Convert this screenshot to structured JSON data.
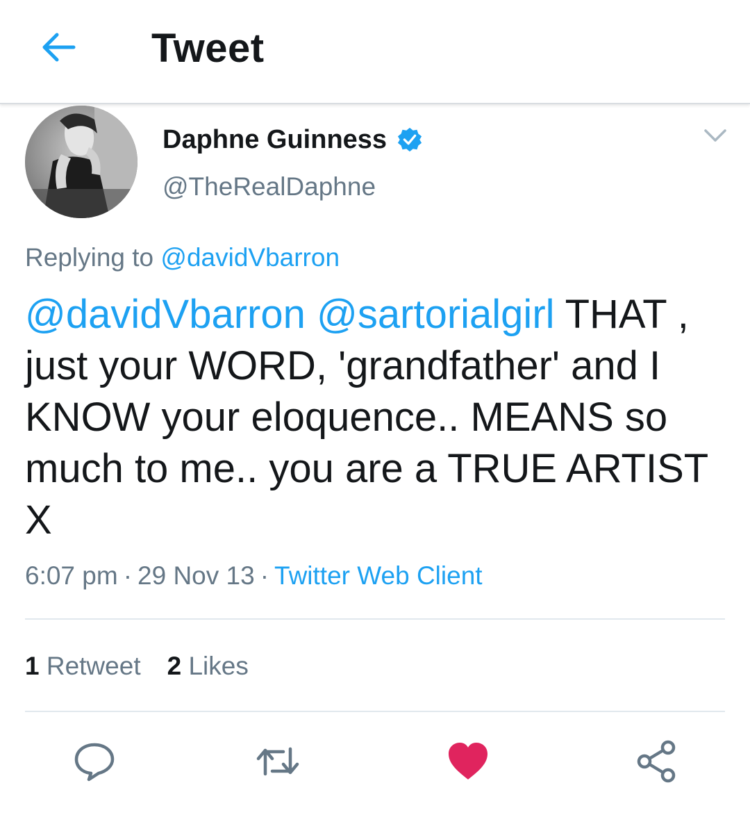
{
  "header": {
    "title": "Tweet",
    "back_icon": "arrow-left-icon"
  },
  "author": {
    "name": "Daphne Guinness",
    "handle": "@TheRealDaphne",
    "verified": true
  },
  "reply": {
    "prefix": "Replying to",
    "handle": "@davidVbarron"
  },
  "tweet": {
    "mention1": "@davidVbarron",
    "mention2": "@sartorialgirl",
    "text": "THAT , just your WORD, 'grandfather' and I KNOW your eloquence.. MEANS so much to me.. you are a TRUE ARTIST X"
  },
  "meta": {
    "time": "6:07 pm",
    "date": "29 Nov 13",
    "source": "Twitter Web Client",
    "separator": "·"
  },
  "stats": {
    "retweets_count": "1",
    "retweets_label": "Retweet",
    "likes_count": "2",
    "likes_label": "Likes"
  },
  "actions": [
    "reply-icon",
    "retweet-icon",
    "like-icon",
    "share-icon"
  ],
  "colors": {
    "accent": "#1da1f2",
    "like": "#e0245e",
    "text": "#14171a",
    "muted": "#657786"
  }
}
